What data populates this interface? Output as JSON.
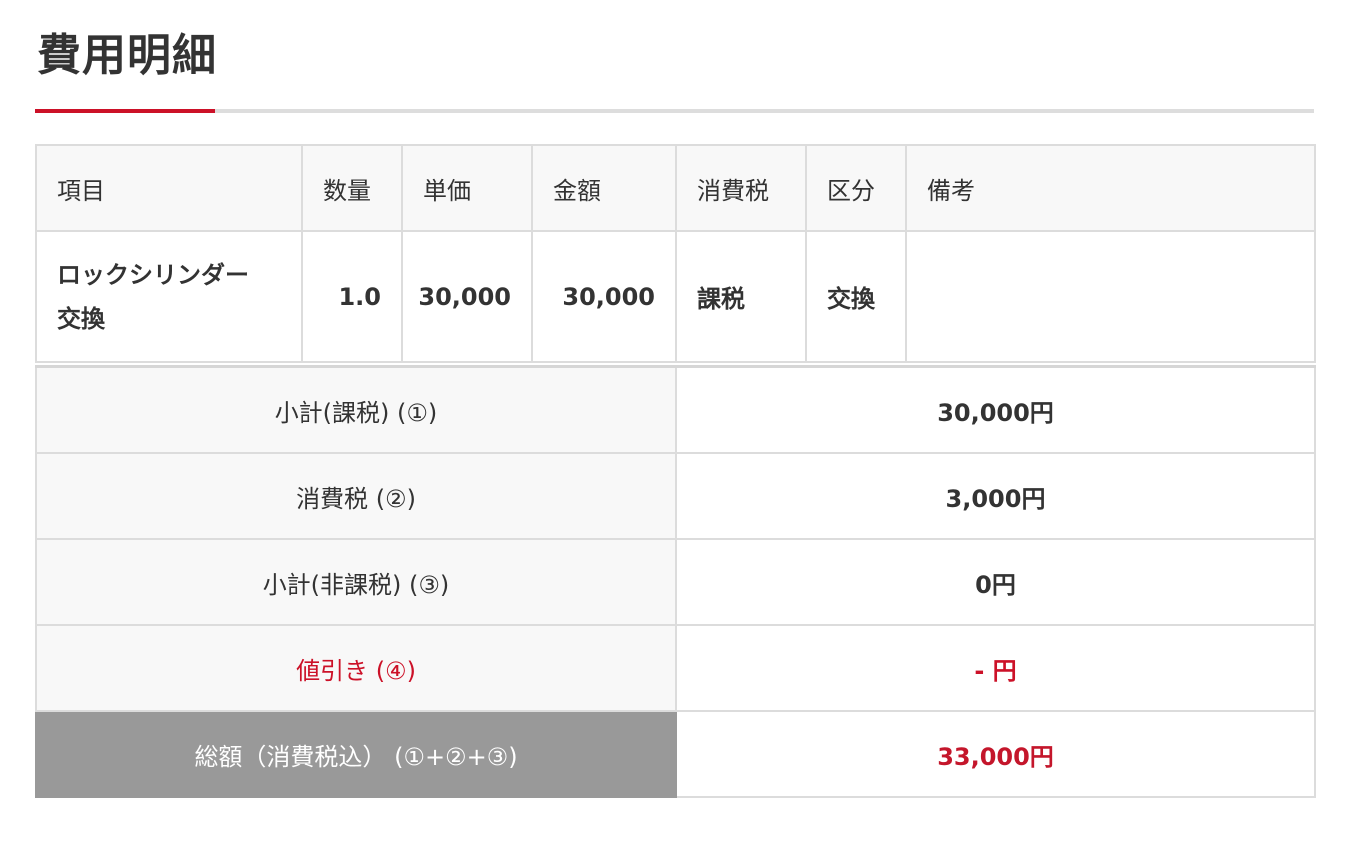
{
  "page": {
    "title": "費用明細",
    "accent_color": "#cc1128"
  },
  "items_table": {
    "headers": [
      "項目",
      "数量",
      "単価",
      "金額",
      "消費税",
      "区分",
      "備考"
    ],
    "rows": [
      {
        "item_line1": "ロックシリンダー",
        "item_line2": "交換",
        "quantity": "1.0",
        "unit_price": "30,000",
        "amount": "30,000",
        "tax": "課税",
        "category": "交換",
        "remarks": ""
      }
    ]
  },
  "summary": {
    "subtotal_taxable_label": "小計(課税) (①)",
    "subtotal_taxable_value": "30,000円",
    "consumption_tax_label": "消費税 (②)",
    "consumption_tax_value": "3,000円",
    "subtotal_nontaxable_label": "小計(非課税) (③)",
    "subtotal_nontaxable_value": "0円",
    "discount_label": "値引き (④)",
    "discount_value": "- 円",
    "total_label": "総額（消費税込） (①+②+③)",
    "total_value": "33,000円"
  }
}
